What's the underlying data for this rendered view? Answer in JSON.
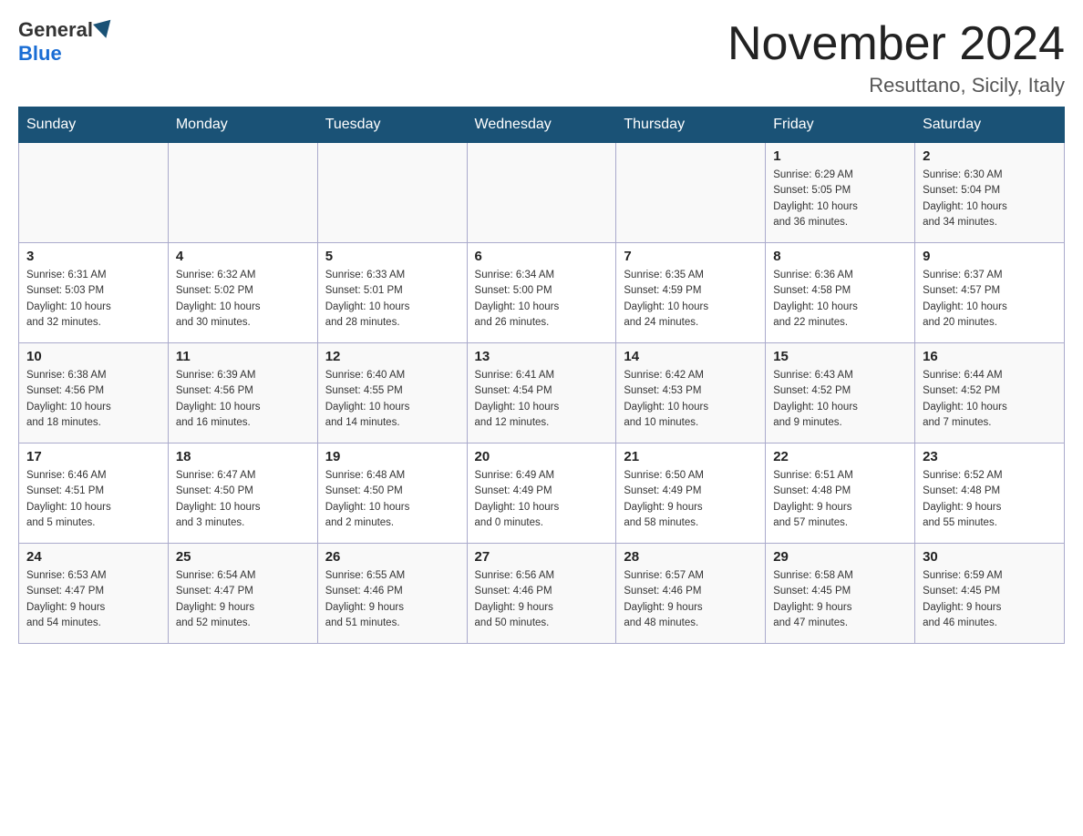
{
  "header": {
    "logo_general": "General",
    "logo_blue": "Blue",
    "month_title": "November 2024",
    "location": "Resuttano, Sicily, Italy"
  },
  "weekdays": [
    "Sunday",
    "Monday",
    "Tuesday",
    "Wednesday",
    "Thursday",
    "Friday",
    "Saturday"
  ],
  "rows": [
    [
      {
        "day": "",
        "info": ""
      },
      {
        "day": "",
        "info": ""
      },
      {
        "day": "",
        "info": ""
      },
      {
        "day": "",
        "info": ""
      },
      {
        "day": "",
        "info": ""
      },
      {
        "day": "1",
        "info": "Sunrise: 6:29 AM\nSunset: 5:05 PM\nDaylight: 10 hours\nand 36 minutes."
      },
      {
        "day": "2",
        "info": "Sunrise: 6:30 AM\nSunset: 5:04 PM\nDaylight: 10 hours\nand 34 minutes."
      }
    ],
    [
      {
        "day": "3",
        "info": "Sunrise: 6:31 AM\nSunset: 5:03 PM\nDaylight: 10 hours\nand 32 minutes."
      },
      {
        "day": "4",
        "info": "Sunrise: 6:32 AM\nSunset: 5:02 PM\nDaylight: 10 hours\nand 30 minutes."
      },
      {
        "day": "5",
        "info": "Sunrise: 6:33 AM\nSunset: 5:01 PM\nDaylight: 10 hours\nand 28 minutes."
      },
      {
        "day": "6",
        "info": "Sunrise: 6:34 AM\nSunset: 5:00 PM\nDaylight: 10 hours\nand 26 minutes."
      },
      {
        "day": "7",
        "info": "Sunrise: 6:35 AM\nSunset: 4:59 PM\nDaylight: 10 hours\nand 24 minutes."
      },
      {
        "day": "8",
        "info": "Sunrise: 6:36 AM\nSunset: 4:58 PM\nDaylight: 10 hours\nand 22 minutes."
      },
      {
        "day": "9",
        "info": "Sunrise: 6:37 AM\nSunset: 4:57 PM\nDaylight: 10 hours\nand 20 minutes."
      }
    ],
    [
      {
        "day": "10",
        "info": "Sunrise: 6:38 AM\nSunset: 4:56 PM\nDaylight: 10 hours\nand 18 minutes."
      },
      {
        "day": "11",
        "info": "Sunrise: 6:39 AM\nSunset: 4:56 PM\nDaylight: 10 hours\nand 16 minutes."
      },
      {
        "day": "12",
        "info": "Sunrise: 6:40 AM\nSunset: 4:55 PM\nDaylight: 10 hours\nand 14 minutes."
      },
      {
        "day": "13",
        "info": "Sunrise: 6:41 AM\nSunset: 4:54 PM\nDaylight: 10 hours\nand 12 minutes."
      },
      {
        "day": "14",
        "info": "Sunrise: 6:42 AM\nSunset: 4:53 PM\nDaylight: 10 hours\nand 10 minutes."
      },
      {
        "day": "15",
        "info": "Sunrise: 6:43 AM\nSunset: 4:52 PM\nDaylight: 10 hours\nand 9 minutes."
      },
      {
        "day": "16",
        "info": "Sunrise: 6:44 AM\nSunset: 4:52 PM\nDaylight: 10 hours\nand 7 minutes."
      }
    ],
    [
      {
        "day": "17",
        "info": "Sunrise: 6:46 AM\nSunset: 4:51 PM\nDaylight: 10 hours\nand 5 minutes."
      },
      {
        "day": "18",
        "info": "Sunrise: 6:47 AM\nSunset: 4:50 PM\nDaylight: 10 hours\nand 3 minutes."
      },
      {
        "day": "19",
        "info": "Sunrise: 6:48 AM\nSunset: 4:50 PM\nDaylight: 10 hours\nand 2 minutes."
      },
      {
        "day": "20",
        "info": "Sunrise: 6:49 AM\nSunset: 4:49 PM\nDaylight: 10 hours\nand 0 minutes."
      },
      {
        "day": "21",
        "info": "Sunrise: 6:50 AM\nSunset: 4:49 PM\nDaylight: 9 hours\nand 58 minutes."
      },
      {
        "day": "22",
        "info": "Sunrise: 6:51 AM\nSunset: 4:48 PM\nDaylight: 9 hours\nand 57 minutes."
      },
      {
        "day": "23",
        "info": "Sunrise: 6:52 AM\nSunset: 4:48 PM\nDaylight: 9 hours\nand 55 minutes."
      }
    ],
    [
      {
        "day": "24",
        "info": "Sunrise: 6:53 AM\nSunset: 4:47 PM\nDaylight: 9 hours\nand 54 minutes."
      },
      {
        "day": "25",
        "info": "Sunrise: 6:54 AM\nSunset: 4:47 PM\nDaylight: 9 hours\nand 52 minutes."
      },
      {
        "day": "26",
        "info": "Sunrise: 6:55 AM\nSunset: 4:46 PM\nDaylight: 9 hours\nand 51 minutes."
      },
      {
        "day": "27",
        "info": "Sunrise: 6:56 AM\nSunset: 4:46 PM\nDaylight: 9 hours\nand 50 minutes."
      },
      {
        "day": "28",
        "info": "Sunrise: 6:57 AM\nSunset: 4:46 PM\nDaylight: 9 hours\nand 48 minutes."
      },
      {
        "day": "29",
        "info": "Sunrise: 6:58 AM\nSunset: 4:45 PM\nDaylight: 9 hours\nand 47 minutes."
      },
      {
        "day": "30",
        "info": "Sunrise: 6:59 AM\nSunset: 4:45 PM\nDaylight: 9 hours\nand 46 minutes."
      }
    ]
  ]
}
